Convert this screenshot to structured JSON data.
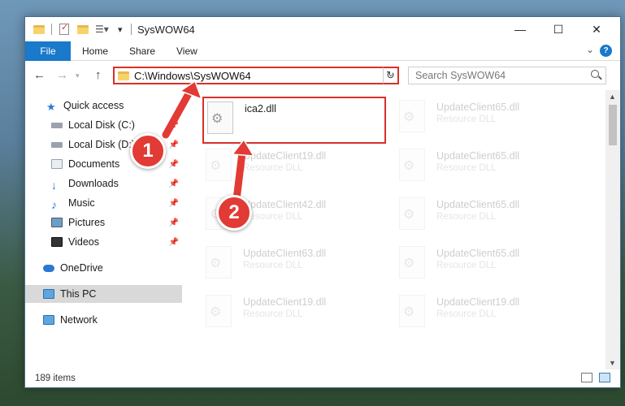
{
  "window": {
    "title": "SysWOW64",
    "controls": {
      "minimize": "—",
      "maximize": "☐",
      "close": "✕"
    }
  },
  "ribbon": {
    "file_tab": "File",
    "tabs": [
      "Home",
      "Share",
      "View"
    ],
    "help": "?"
  },
  "navbar": {
    "back": "←",
    "forward": "→",
    "up": "↑",
    "address": "C:\\Windows\\SysWOW64",
    "refresh": "↻",
    "search_placeholder": "Search SysWOW64"
  },
  "sidebar": {
    "items": [
      {
        "label": "Quick access",
        "icon": "star-icon",
        "pinned": false
      },
      {
        "label": "Local Disk (C:)",
        "icon": "drive-icon",
        "pinned": true
      },
      {
        "label": "Local Disk (D:)",
        "icon": "drive-icon",
        "pinned": true
      },
      {
        "label": "Documents",
        "icon": "documents-icon",
        "pinned": true
      },
      {
        "label": "Downloads",
        "icon": "download-icon",
        "pinned": true
      },
      {
        "label": "Music",
        "icon": "music-icon",
        "pinned": true
      },
      {
        "label": "Pictures",
        "icon": "pictures-icon",
        "pinned": true
      },
      {
        "label": "Videos",
        "icon": "videos-icon",
        "pinned": true
      },
      {
        "label": "OneDrive",
        "icon": "cloud-icon",
        "pinned": false
      },
      {
        "label": "This PC",
        "icon": "computer-icon",
        "pinned": false,
        "selected": true
      },
      {
        "label": "Network",
        "icon": "network-icon",
        "pinned": false
      }
    ]
  },
  "files": {
    "highlighted": {
      "name": "ica2.dll",
      "type": ""
    },
    "right_column": [
      {
        "name": "UpdateClient65.dll",
        "type": "Resource DLL"
      },
      {
        "name": "UpdateClient65.dll",
        "type": "Resource DLL"
      },
      {
        "name": "UpdateClient65.dll",
        "type": "Resource DLL"
      },
      {
        "name": "UpdateClient65.dll",
        "type": "Resource DLL"
      },
      {
        "name": "UpdateClient19.dll",
        "type": "Resource DLL"
      }
    ],
    "left_column": [
      {
        "name": "UpdateClient19.dll",
        "type": "Resource DLL"
      },
      {
        "name": "UpdateClient42.dll",
        "type": "Resource DLL"
      },
      {
        "name": "UpdateClient63.dll",
        "type": "Resource DLL"
      },
      {
        "name": "UpdateClient19.dll",
        "type": "Resource DLL"
      }
    ]
  },
  "status": {
    "item_count": "189 items"
  },
  "callouts": {
    "step1": "1",
    "step2": "2"
  },
  "colors": {
    "accent": "#1979ca",
    "callout": "#e23a34",
    "highlight_border": "#d9302c"
  }
}
